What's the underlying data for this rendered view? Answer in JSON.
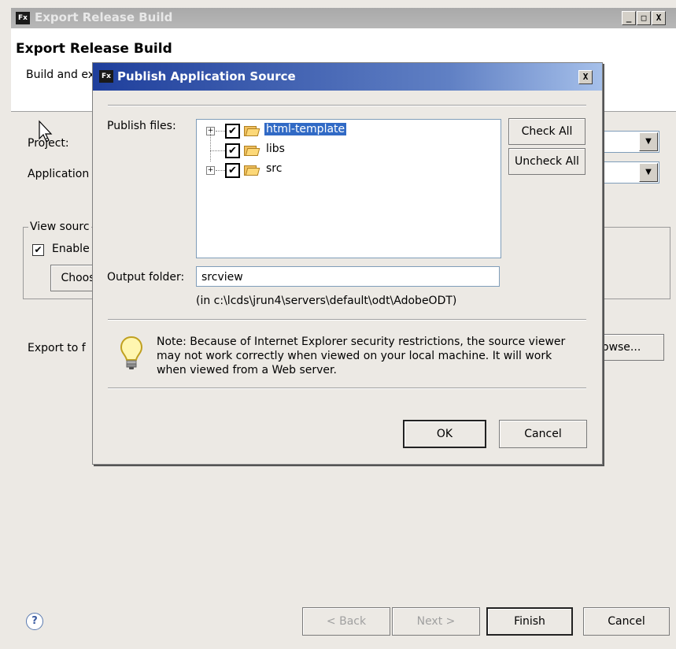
{
  "outer_window": {
    "title": "Export Release Build",
    "heading": "Export Release Build",
    "description": "Build and ex",
    "project_label": "Project:",
    "application_label": "Application",
    "view_source_group": "View sourc",
    "enable_label": "Enable",
    "choose_button": "Choos",
    "export_label": "Export to f",
    "browse_button": "owse...",
    "help_icon": "?",
    "back_button": "< Back",
    "next_button": "Next >",
    "finish_button": "Finish",
    "cancel_button": "Cancel",
    "window_controls": [
      "_",
      "□",
      "X"
    ]
  },
  "dialog": {
    "title": "Publish Application Source",
    "close_label": "X",
    "publish_files_label": "Publish files:",
    "tree": [
      {
        "label": "html-template",
        "checked": true,
        "expandable": true,
        "selected": true
      },
      {
        "label": "libs",
        "checked": true,
        "expandable": false,
        "selected": false
      },
      {
        "label": "src",
        "checked": true,
        "expandable": true,
        "selected": false
      }
    ],
    "check_all_button": "Check All",
    "uncheck_all_button": "Uncheck All",
    "output_folder_label": "Output folder:",
    "output_folder_value": "srcview",
    "output_path_note": "(in c:\\lcds\\jrun4\\servers\\default\\odt\\AdobeODT)",
    "note_line1": "Note: Because of Internet Explorer security restrictions, the source viewer",
    "note_line2": "may not work correctly when viewed on your local machine. It will work",
    "note_line3": "when viewed from a Web server.",
    "ok_button": "OK",
    "cancel_button": "Cancel"
  },
  "icons": {
    "app_logo": "Fx",
    "folder_icon": "folder-open-icon",
    "note_icon": "lightbulb-icon"
  }
}
